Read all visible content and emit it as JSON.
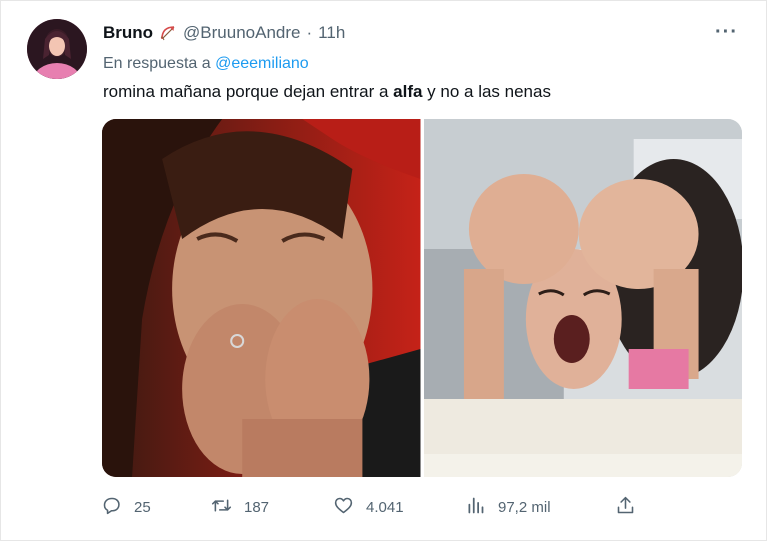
{
  "author": {
    "display_name": "Bruno",
    "handle": "@BruunoAndre",
    "separator": "·",
    "time": "11h",
    "avatar_icon": "avatar-photo",
    "name_emoji_icon": "bow-arrow-icon"
  },
  "reply": {
    "prefix": "En respuesta a",
    "mention": "@eeemiliano"
  },
  "tweet": {
    "text_before": "romina mañana porque dejan entrar a ",
    "text_bold": "alfa",
    "text_after": " y no a las nenas"
  },
  "media": {
    "images": [
      {
        "icon": "crying-woman-photo"
      },
      {
        "icon": "shocked-woman-photo"
      }
    ]
  },
  "actions": {
    "reply_count": "25",
    "retweet_count": "187",
    "like_count": "4.041",
    "views_count": "97,2 mil"
  },
  "colors": {
    "text": "#0f1419",
    "secondary": "#536471",
    "link": "#1d9bf0"
  }
}
